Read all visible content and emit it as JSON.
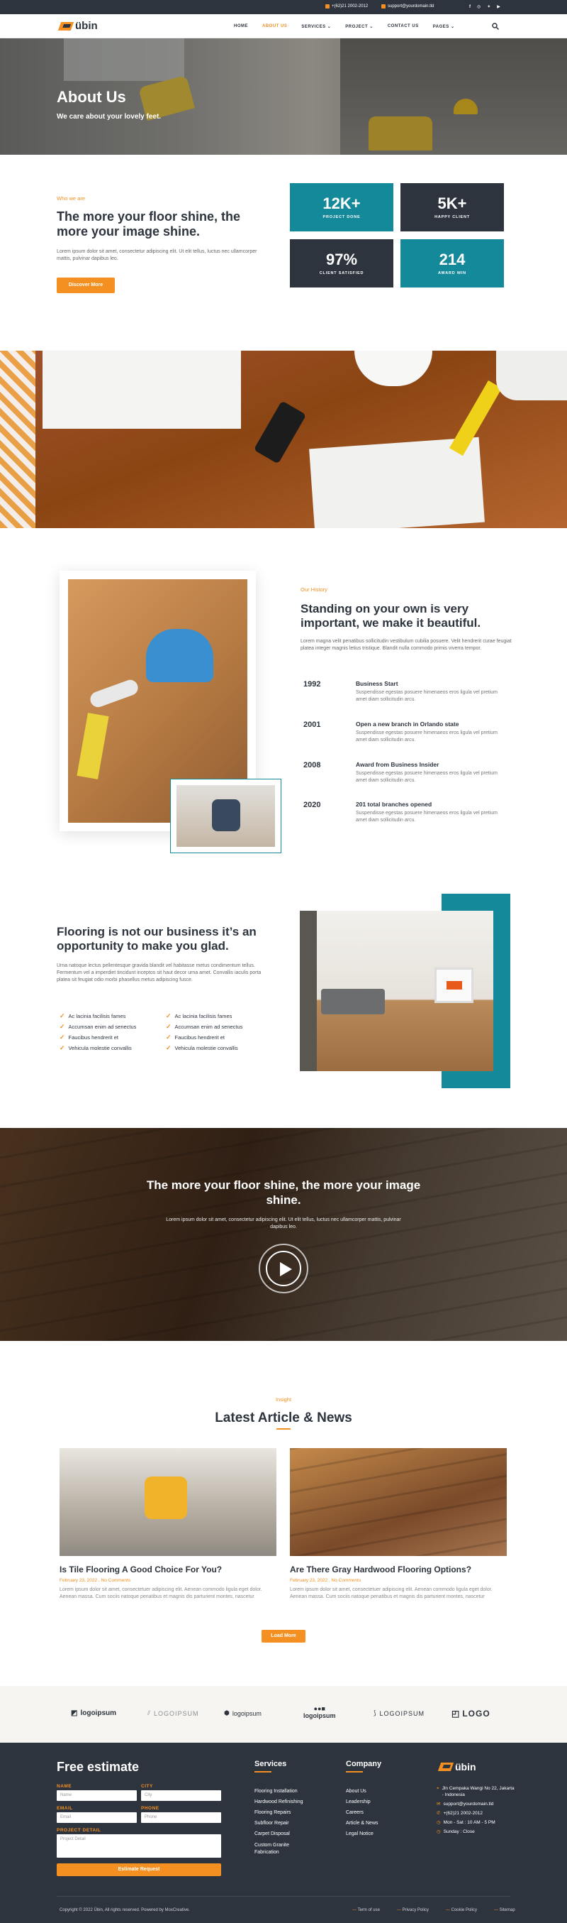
{
  "topbar": {
    "phone": "+(62)21 2002-2012",
    "email": "support@yourdomain.tld",
    "social_icons": [
      "facebook-icon",
      "instagram-icon",
      "twitter-icon",
      "youtube-icon"
    ]
  },
  "brand": {
    "name": "übin",
    "accent": "#f39021",
    "dark": "#2d343e",
    "teal": "#14899a"
  },
  "nav": {
    "items": [
      {
        "label": "HOME"
      },
      {
        "label": "ABOUT US",
        "active": true
      },
      {
        "label": "SERVICES",
        "dropdown": true
      },
      {
        "label": "PROJECT",
        "dropdown": true
      },
      {
        "label": "CONTACT US"
      },
      {
        "label": "PAGES",
        "dropdown": true
      }
    ]
  },
  "hero": {
    "title": "About Us",
    "subtitle": "We care about your lovely feet."
  },
  "who": {
    "eyebrow": "Who we are",
    "title": "The more your floor shine, the more your image shine.",
    "text": "Lorem ipsum dolor sit amet, consectetur adipiscing elit. Ut elit tellus, luctus nec ullamcorper mattis, pulvinar dapibus leo.",
    "button": "Discover More",
    "stats": [
      {
        "value": "12K+",
        "label": "PROJECT DONE"
      },
      {
        "value": "5K+",
        "label": "HAPPY CLIENT"
      },
      {
        "value": "97%",
        "label": "CLIENT SATISFIED"
      },
      {
        "value": "214",
        "label": "AWARD WIN"
      }
    ]
  },
  "history": {
    "eyebrow": "Our History",
    "title": "Standing on your own is very important, we make it beautiful.",
    "text": "Lorem magna velit penatibus sollicitudin vestibulum cubilia posuere. Velit hendrerit curae feugiat platea integer magnis letius tristique. Blandit nulla commodo primis viverra tempor.",
    "timeline": [
      {
        "year": "1992",
        "title": "Business Start",
        "desc": "Suspendisse egestas posuere himenaeos eros ligula vel pretium amet diam sollicitudin arcu."
      },
      {
        "year": "2001",
        "title": "Open a new branch in Orlando state",
        "desc": "Suspendisse egestas posuere himenaeos eros ligula vel pretium amet diam sollicitudin arcu."
      },
      {
        "year": "2008",
        "title": "Award from Business Insider",
        "desc": "Suspendisse egestas posuere himenaeos eros ligula vel pretium amet diam sollicitudin arcu."
      },
      {
        "year": "2020",
        "title": "201 total branches opened",
        "desc": "Suspendisse egestas posuere himenaeos eros ligula vel pretium amet diam sollicitudin arcu."
      }
    ]
  },
  "business": {
    "title": "Flooring is not our business it’s an opportunity to make you glad.",
    "text": "Urna natoque lectus pellentesque gravida blandit vel habitasse metus condimentum tellus. Fermentum vel a imperdiet tincidunt inceptos sit haut decor urna amet. Convallis iaculis porta platea sit feugiat odio morbi phasellus metus adipiscing fusce.",
    "checks_left": [
      "Ac lacinia facilisis fames",
      "Accumsan enim ad senectus",
      "Faucibus hendrerit et",
      "Vehicula molestie convallis"
    ],
    "checks_right": [
      "Ac lacinia facilisis fames",
      "Accumsan enim ad senectus",
      "Faucibus hendrerit et",
      "Vehicula molestie convallis"
    ]
  },
  "video": {
    "title": "The more your floor shine, the more your image shine.",
    "text": "Lorem ipsum dolor sit amet, consectetur adipiscing elit. Ut elit tellus, luctus nec ullamcorper mattis, pulvinar dapibus leo."
  },
  "news": {
    "eyebrow": "Insight",
    "title": "Latest Article & News",
    "articles": [
      {
        "title": "Is Tile Flooring A Good Choice For You?",
        "date": "February 23, 2022 , No Comments",
        "excerpt": "Lorem ipsum dolor sit amet, consectetuer adipiscing elit. Aenean commodo ligula eget dolor. Aenean massa. Cum sociis natoque penatibus et magnis dis parturient montes, nascetur"
      },
      {
        "title": "Are There Gray Hardwood Flooring Options?",
        "date": "February 23, 2022 , No Comments",
        "excerpt": "Lorem ipsum dolor sit amet, consectetuer adipiscing elit. Aenean commodo ligula eget dolor. Aenean massa. Cum sociis natoque penatibus et magnis dis parturient montes, nascetur"
      }
    ],
    "button": "Load More"
  },
  "logos": [
    "logoipsum",
    "LOGOIPSUM",
    "logoipsum",
    "logoipsum",
    "LOGOIPSUM",
    "LOGO"
  ],
  "footer": {
    "estimate": {
      "title": "Free estimate",
      "name_label": "NAME",
      "name_ph": "Name",
      "city_label": "CITY",
      "city_ph": "City",
      "email_label": "EMAIL",
      "email_ph": "Email",
      "phone_label": "PHONE",
      "phone_ph": "Phone",
      "detail_label": "PROJECT DETAIL",
      "detail_ph": "Project Detail",
      "button": "Estimate Request"
    },
    "services_title": "Services",
    "services": [
      "Flooring Installation",
      "Hardwood Refinishing",
      "Flooring Repairs",
      "Subfloor Repair",
      "Carpet Disposal",
      "Custom Granite Fabrication"
    ],
    "company_title": "Company",
    "company": [
      "About Us",
      "Leadership",
      "Careers",
      "Article & News",
      "Legal Notice"
    ],
    "contact": {
      "address": "Jln Cempaka Wangi No 22, Jakarta - Indonesia",
      "email": "support@yourdomain.tld",
      "phone": "+(62)21 2002-2012",
      "hours1": "Mon - Sat : 10 AM - 5 PM",
      "hours2": "Sunday : Close"
    },
    "copyright": "Copyright © 2022 Übin, All rights reserved. Powered by MoxCreative.",
    "legal": [
      "Term of use",
      "Privacy Policy",
      "Cookie Policy",
      "Sitemap"
    ]
  }
}
